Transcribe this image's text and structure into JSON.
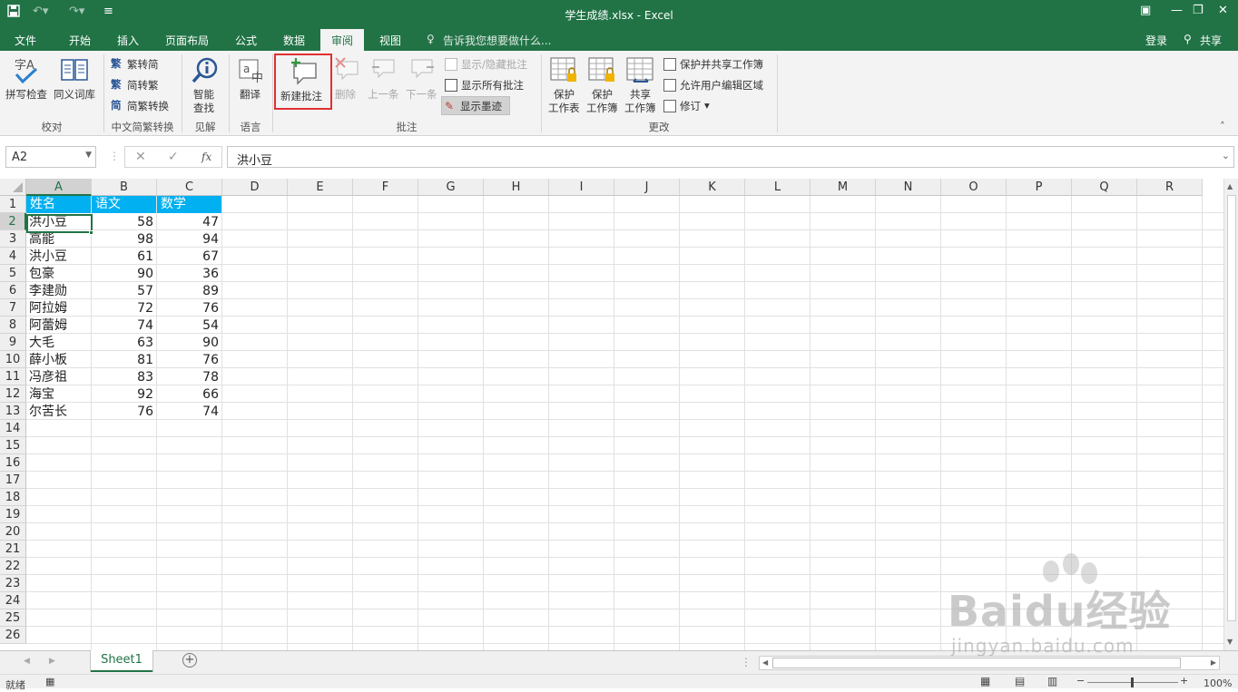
{
  "window": {
    "title": "学生成绩.xlsx - Excel"
  },
  "tabs": [
    "文件",
    "开始",
    "插入",
    "页面布局",
    "公式",
    "数据",
    "审阅",
    "视图"
  ],
  "tell_me": "告诉我您想要做什么...",
  "account": {
    "login": "登录",
    "share": "共享"
  },
  "ribbon": {
    "proofing": {
      "spell": "拼写检查",
      "thesaurus": "同义词库",
      "group": "校对"
    },
    "chinese": {
      "t2s": "繁转简",
      "s2t": "简转繁",
      "convert": "简繁转换",
      "group": "中文简繁转换"
    },
    "insights": {
      "smart_line1": "智能",
      "smart_line2": "查找",
      "group": "见解"
    },
    "language": {
      "translate": "翻译",
      "group": "语言"
    },
    "comments": {
      "new": "新建批注",
      "delete": "删除",
      "prev": "上一条",
      "next": "下一条",
      "show_hide": "显示/隐藏批注",
      "show_all": "显示所有批注",
      "show_ink": "显示墨迹",
      "group": "批注"
    },
    "changes": {
      "protect_sheet_1": "保护",
      "protect_sheet_2": "工作表",
      "protect_wb_1": "保护",
      "protect_wb_2": "工作簿",
      "share_wb_1": "共享",
      "share_wb_2": "工作簿",
      "protect_share": "保护并共享工作簿",
      "allow_edit": "允许用户编辑区域",
      "track": "修订",
      "group": "更改"
    }
  },
  "formula_bar": {
    "name_box": "A2",
    "fx": "fx",
    "value": "洪小豆"
  },
  "columns": [
    "A",
    "B",
    "C",
    "D",
    "E",
    "F",
    "G",
    "H",
    "I",
    "J",
    "K",
    "L",
    "M",
    "N",
    "O",
    "P",
    "Q",
    "R"
  ],
  "rows": [
    "1",
    "2",
    "3",
    "4",
    "5",
    "6",
    "7",
    "8",
    "9",
    "10",
    "11",
    "12",
    "13",
    "14",
    "15",
    "16",
    "17",
    "18",
    "19",
    "20",
    "21",
    "22",
    "23",
    "24",
    "25",
    "26"
  ],
  "table": {
    "headers": [
      "姓名",
      "语文",
      "数学"
    ],
    "data": [
      [
        "洪小豆",
        "58",
        "47"
      ],
      [
        "高能",
        "98",
        "94"
      ],
      [
        "洪小豆",
        "61",
        "67"
      ],
      [
        "包豪",
        "90",
        "36"
      ],
      [
        "李建勋",
        "57",
        "89"
      ],
      [
        "阿拉姆",
        "72",
        "76"
      ],
      [
        "阿蕾姆",
        "74",
        "54"
      ],
      [
        "大毛",
        "63",
        "90"
      ],
      [
        "薛小板",
        "81",
        "76"
      ],
      [
        "冯彦祖",
        "83",
        "78"
      ],
      [
        "海宝",
        "92",
        "66"
      ],
      [
        "尔苦长",
        "76",
        "74"
      ]
    ]
  },
  "sheet_tab": "Sheet1",
  "status": {
    "ready": "就绪",
    "zoom": "100%"
  },
  "watermark": {
    "brand": "Baidu经验",
    "url": "jingyan.baidu.com"
  },
  "colors": {
    "accent": "#217346",
    "header_fill": "#00b0f0",
    "highlight": "#e03030"
  }
}
